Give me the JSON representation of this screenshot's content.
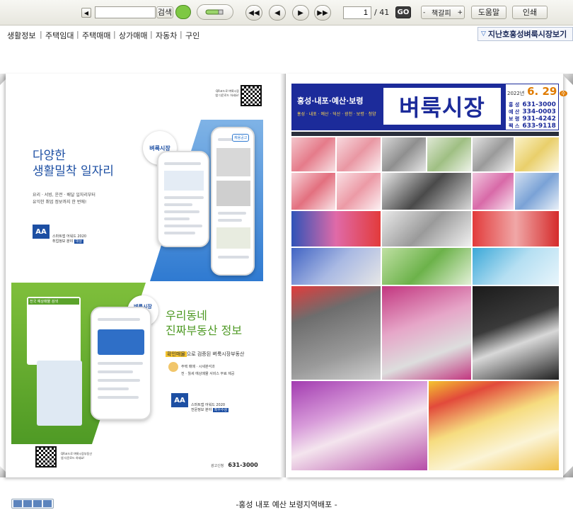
{
  "toolbar": {
    "search_placeholder": "",
    "search_button": "검색",
    "page_current": "1",
    "page_total": "/ 41",
    "go_button": "GO",
    "text_size_label": "책갈피",
    "text_size_minus": "-",
    "text_size_plus": "+",
    "help_button": "도움말",
    "print_button": "인쇄"
  },
  "menu": {
    "items": [
      "생활정보",
      "주택임대",
      "주택매매",
      "상가매매",
      "자동차",
      "구인"
    ],
    "separator": "|",
    "past_issue_button": "지난호홍성벼룩시장보기"
  },
  "left_page": {
    "ad_top": {
      "qr_caption_1": "QR코드로 벼룩시장",
      "qr_caption_2": "앱 다운로드 하세요!",
      "headline_1": "다양한",
      "headline_2": "생활밀착 일자리",
      "body_1": "요리 · 서빙, 운전 · 배달 일자리부터",
      "body_2": "유익한 취업 정보까지 한 번에!",
      "brand_badge": "벼룩시장",
      "award_1": "스마트앱 어워드 2020",
      "award_2": "취업정보 분야",
      "award_tag": "대상",
      "phone_tag": "채용공고"
    },
    "ad_bottom": {
      "badge_1": "벼룩시장",
      "badge_2": "부동산",
      "headline_1": "우리동네",
      "headline_2": "진짜부동산 정보",
      "highlight": "확인매물",
      "subline": "으로 검증된 벼룩시장부동산",
      "bullet_1": "주택 매매 · 시세분석과",
      "bullet_2": "전 · 월세 예상매물 서비스 무료 제공",
      "award_1": "스마트앱 어워드 2020",
      "award_2": "전문정보 분야",
      "award_tag": "최우수상",
      "map_label": "전국 예상매물 검색"
    },
    "footer": {
      "qr_caption_1": "QR코드로 벼룩시장부동산",
      "qr_caption_2": "앱 다운로드 하세요!",
      "phone_label": "광고신청",
      "phone": "631-3000"
    }
  },
  "right_page": {
    "masthead_regions": "홍성·내포·예산·보령",
    "masthead_title": "벼룩시장",
    "masthead_sub": "홍성 · 내포 · 예산 · 덕산 · 광천 · 보령 · 청양",
    "date_year": "2022년",
    "date_md": "6. 29",
    "date_day": "수",
    "contacts": [
      {
        "region": "홍 성",
        "phone": "631-3000"
      },
      {
        "region": "예 산",
        "phone": "334-0003"
      },
      {
        "region": "보 령",
        "phone": "931-4242"
      },
      {
        "region": "팩 스",
        "phone": "633-9118"
      }
    ]
  },
  "footer": {
    "caption": "-홍성 내포 예산 보령지역배포 -"
  },
  "colors": {
    "masthead_blue": "#1c2b9a",
    "green": "#5ba32b",
    "blue": "#2f7ad1",
    "magenta": "#c2367f",
    "yellow": "#f4c430"
  }
}
